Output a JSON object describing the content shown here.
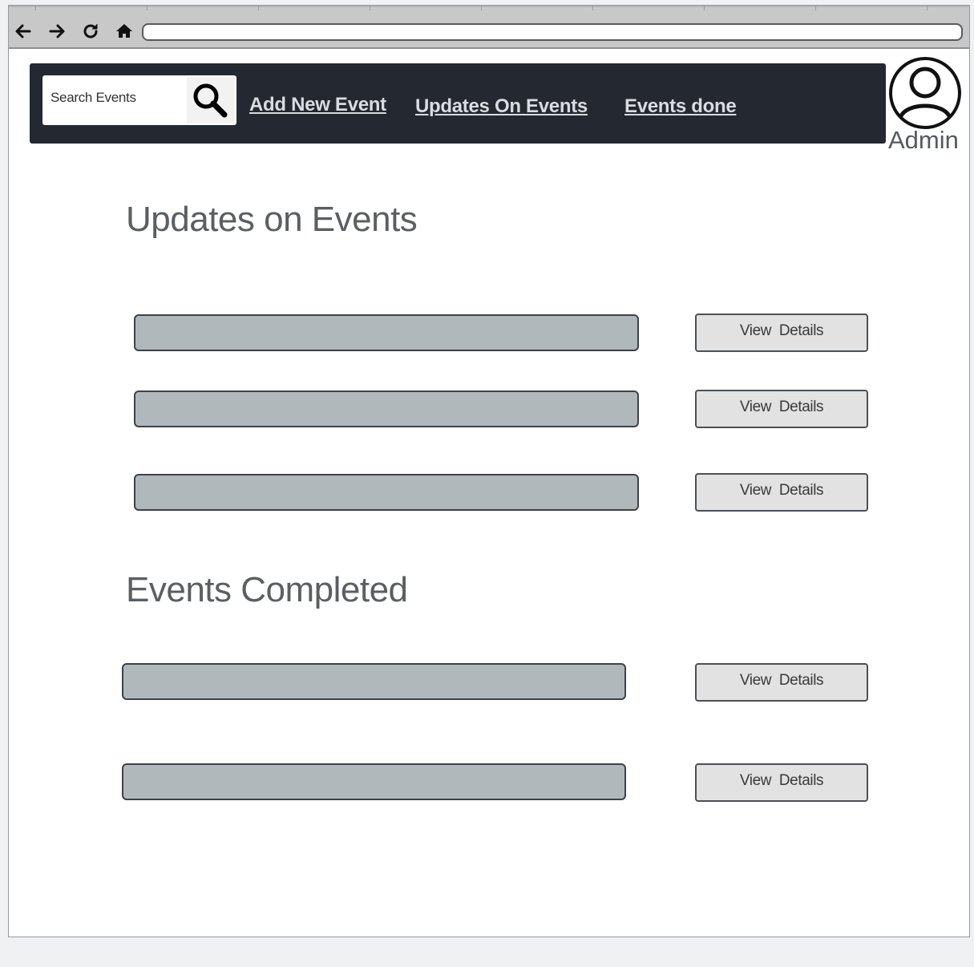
{
  "browser": {
    "address_value": "",
    "nav_icons": [
      "back-arrow-icon",
      "forward-arrow-icon",
      "reload-icon",
      "home-icon"
    ]
  },
  "header": {
    "background_color": "#232831",
    "search": {
      "placeholder": "Search Events",
      "icon": "search-icon"
    },
    "nav_links": [
      {
        "label": "Add New Event"
      },
      {
        "label": "Updates On Events"
      },
      {
        "label": "Events done"
      }
    ]
  },
  "user": {
    "icon": "user-avatar-icon",
    "label": "Admin"
  },
  "sections": [
    {
      "title": "Updates on Events",
      "rows": [
        {
          "button_label": "View  Details"
        },
        {
          "button_label": "View  Details"
        },
        {
          "button_label": "View  Details"
        }
      ]
    },
    {
      "title": "Events Completed",
      "rows": [
        {
          "button_label": "View  Details"
        },
        {
          "button_label": "View  Details"
        }
      ]
    }
  ]
}
